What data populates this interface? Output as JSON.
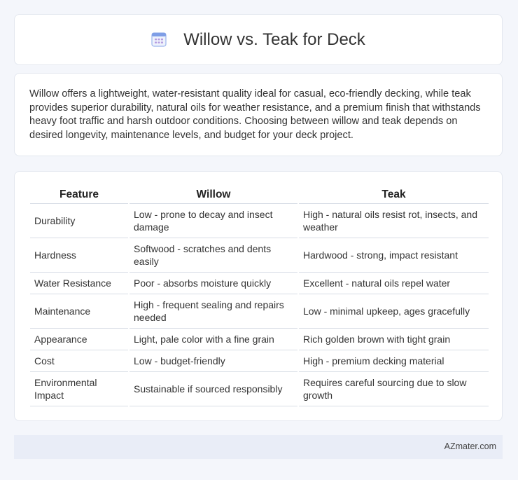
{
  "header": {
    "title": "Willow vs. Teak for Deck",
    "icon": "calendar-icon",
    "icon_color": "#8aa6e8"
  },
  "intro": {
    "text": "Willow offers a lightweight, water-resistant quality ideal for casual, eco-friendly decking, while teak provides superior durability, natural oils for weather resistance, and a premium finish that withstands heavy foot traffic and harsh outdoor conditions. Choosing between willow and teak depends on desired longevity, maintenance levels, and budget for your deck project."
  },
  "table": {
    "headers": [
      "Feature",
      "Willow",
      "Teak"
    ],
    "rows": [
      [
        "Durability",
        "Low - prone to decay and insect damage",
        "High - natural oils resist rot, insects, and weather"
      ],
      [
        "Hardness",
        "Softwood - scratches and dents easily",
        "Hardwood - strong, impact resistant"
      ],
      [
        "Water Resistance",
        "Poor - absorbs moisture quickly",
        "Excellent - natural oils repel water"
      ],
      [
        "Maintenance",
        "High - frequent sealing and repairs needed",
        "Low - minimal upkeep, ages gracefully"
      ],
      [
        "Appearance",
        "Light, pale color with a fine grain",
        "Rich golden brown with tight grain"
      ],
      [
        "Cost",
        "Low - budget-friendly",
        "High - premium decking material"
      ],
      [
        "Environmental Impact",
        "Sustainable if sourced responsibly",
        "Requires careful sourcing due to slow growth"
      ]
    ]
  },
  "footer": {
    "text": "AZmater.com"
  }
}
